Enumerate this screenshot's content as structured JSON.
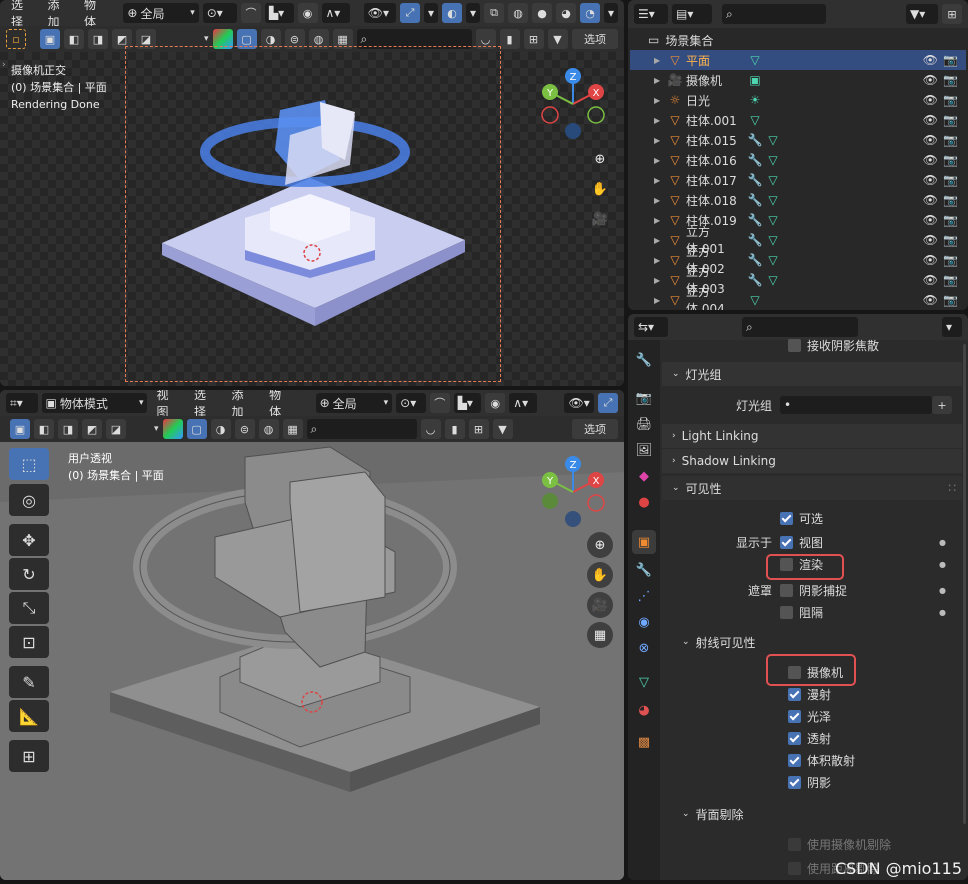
{
  "top_viewport": {
    "menu": [
      "选择",
      "添加",
      "物体"
    ],
    "transform": "全局",
    "options_label": "选项",
    "overlay_lines": [
      "摄像机正交",
      "(0) 场景集合 | 平面",
      "Rendering Done"
    ]
  },
  "bottom_viewport": {
    "mode": "物体模式",
    "menu": [
      "视图",
      "选择",
      "添加",
      "物体"
    ],
    "transform": "全局",
    "options_label": "选项",
    "overlay_lines": [
      "用户透视",
      "(0) 场景集合 | 平面"
    ]
  },
  "gizmo": {
    "z": "Z",
    "y": "Y",
    "x": "X"
  },
  "outliner": {
    "collection": "场景集合",
    "items": [
      {
        "name": "平面",
        "icon": "mesh",
        "selected": true
      },
      {
        "name": "摄像机",
        "icon": "camera"
      },
      {
        "name": "日光",
        "icon": "light"
      },
      {
        "name": "柱体.001",
        "icon": "mesh"
      },
      {
        "name": "柱体.015",
        "icon": "mesh",
        "mod": true
      },
      {
        "name": "柱体.016",
        "icon": "mesh",
        "mod": true
      },
      {
        "name": "柱体.017",
        "icon": "mesh",
        "mod": true
      },
      {
        "name": "柱体.018",
        "icon": "mesh",
        "mod": true
      },
      {
        "name": "柱体.019",
        "icon": "mesh",
        "mod": true
      },
      {
        "name": "立方体.001",
        "icon": "mesh",
        "mod": true
      },
      {
        "name": "立方体.002",
        "icon": "mesh",
        "mod": true
      },
      {
        "name": "立方体.003",
        "icon": "mesh",
        "mod": true
      },
      {
        "name": "立方体.004",
        "icon": "mesh"
      }
    ]
  },
  "properties": {
    "receive_caustics": "接收阴影焦散",
    "light_group_section": "灯光组",
    "light_group_label": "灯光组",
    "light_linking": "Light Linking",
    "shadow_linking": "Shadow Linking",
    "visibility_section": "可见性",
    "selectable": "可选",
    "show_in": "显示于",
    "viewport": "视图",
    "render": "渲染",
    "mask": "遮罩",
    "shadow_catcher": "阴影捕捉",
    "holdout": "阻隔",
    "ray_visibility_section": "射线可见性",
    "camera": "摄像机",
    "diffuse": "漫射",
    "glossy": "光泽",
    "transmission": "透射",
    "volume_scatter": "体积散射",
    "shadow": "阴影",
    "backface_section": "背面剔除",
    "use_camera_cull": "使用摄像机剔除",
    "use_distance_cull": "使用距离剔除"
  },
  "watermark": "CSDN @mio115",
  "colors": {
    "accent": "#4772b3",
    "highlight": "#e25152",
    "mesh": "#ef8e35",
    "data": "#4dd6b0"
  }
}
